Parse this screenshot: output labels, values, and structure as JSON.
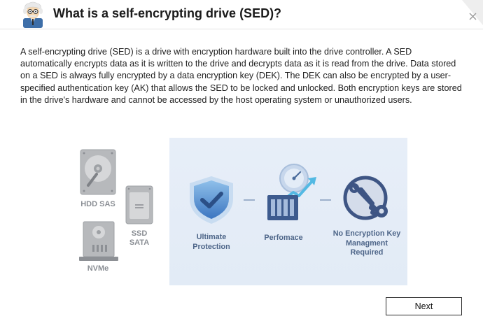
{
  "dialog": {
    "title": "What is a self-encrypting drive (SED)?",
    "close_icon": "close-icon"
  },
  "description": "A self-encrypting drive (SED) is a drive with encryption hardware built into the drive controller. A SED automatically encrypts data as it is written to the drive and decrypts data as it is read from the drive. Data stored on a SED is always fully encrypted by a data encryption key (DEK). The DEK can also be encrypted by a user-specified authentication key (AK) that allows the SED to be locked and unlocked. Both encryption keys are stored in the drive's hardware and cannot be accessed by the host operating system or unauthorized users.",
  "drives": {
    "hdd_sas": "HDD SAS",
    "ssd_sata_line1": "SSD",
    "ssd_sata_line2": "SATA",
    "nvme": "NVMe"
  },
  "features": {
    "protection_line1": "Ultimate",
    "protection_line2": "Protection",
    "performance": "Perfomace",
    "nokey_line1": "No Encryption Key",
    "nokey_line2": "Managment",
    "nokey_line3": "Required"
  },
  "footer": {
    "next_label": "Next"
  },
  "colors": {
    "panel_bg": "#e4ecf7",
    "accent_blue": "#3f78c4",
    "label_blue": "#4d6588",
    "drive_gray": "#8a8e94"
  }
}
